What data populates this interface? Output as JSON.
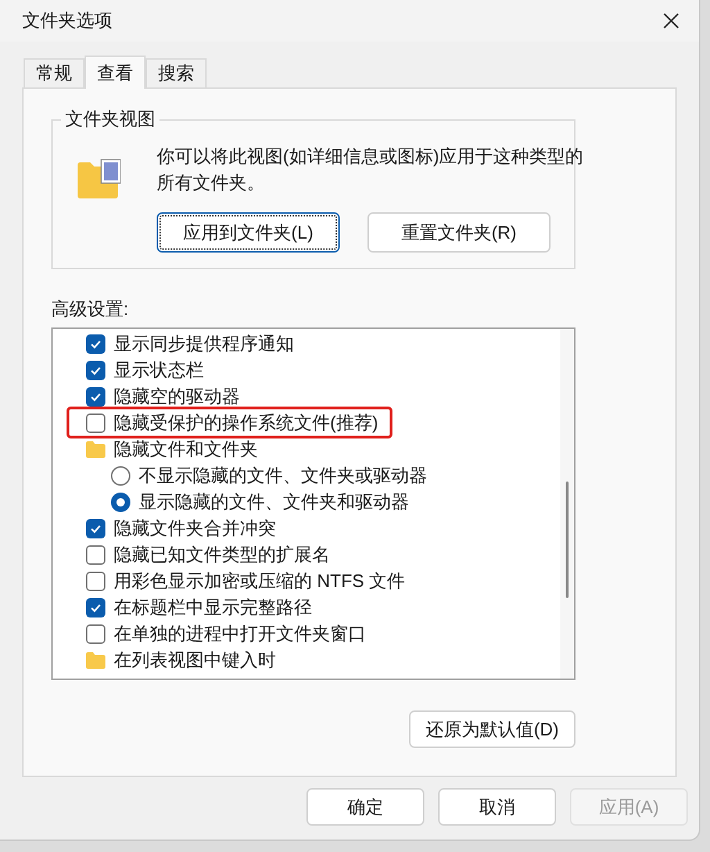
{
  "window": {
    "title": "文件夹选项"
  },
  "tabs": [
    {
      "label": "常规",
      "selected": false
    },
    {
      "label": "查看",
      "selected": true
    },
    {
      "label": "搜索",
      "selected": false
    }
  ],
  "folder_views": {
    "title": "文件夹视图",
    "description": "你可以将此视图(如详细信息或图标)应用于这种类型的所有文件夹。",
    "buttons": [
      {
        "label": "应用到文件夹(L)",
        "focused": true
      },
      {
        "label": "重置文件夹(R)",
        "focused": false
      }
    ]
  },
  "advanced": {
    "label": "高级设置:",
    "items": [
      {
        "kind": "checkbox",
        "label": "显示同步提供程序通知",
        "checked": true,
        "highlighted": false
      },
      {
        "kind": "checkbox",
        "label": "显示状态栏",
        "checked": true,
        "highlighted": false
      },
      {
        "kind": "checkbox",
        "label": "隐藏空的驱动器",
        "checked": true,
        "highlighted": false
      },
      {
        "kind": "checkbox",
        "label": "隐藏受保护的操作系统文件(推荐)",
        "checked": false,
        "highlighted": true
      },
      {
        "kind": "folder",
        "label": "隐藏文件和文件夹",
        "children": [
          {
            "kind": "radio",
            "label": "不显示隐藏的文件、文件夹或驱动器",
            "selected": false
          },
          {
            "kind": "radio",
            "label": "显示隐藏的文件、文件夹和驱动器",
            "selected": true
          }
        ]
      },
      {
        "kind": "checkbox",
        "label": "隐藏文件夹合并冲突",
        "checked": true,
        "highlighted": false
      },
      {
        "kind": "checkbox",
        "label": "隐藏已知文件类型的扩展名",
        "checked": false,
        "highlighted": false
      },
      {
        "kind": "checkbox",
        "label": "用彩色显示加密或压缩的 NTFS 文件",
        "checked": false,
        "highlighted": false
      },
      {
        "kind": "checkbox",
        "label": "在标题栏中显示完整路径",
        "checked": true,
        "highlighted": false
      },
      {
        "kind": "checkbox",
        "label": "在单独的进程中打开文件夹窗口",
        "checked": false,
        "highlighted": false
      },
      {
        "kind": "folder",
        "label": "在列表视图中键入时"
      }
    ],
    "restore_button": "还原为默认值(D)"
  },
  "buttons": [
    {
      "label": "确定",
      "disabled": false
    },
    {
      "label": "取消",
      "disabled": false
    },
    {
      "label": "应用(A)",
      "disabled": true
    }
  ]
}
